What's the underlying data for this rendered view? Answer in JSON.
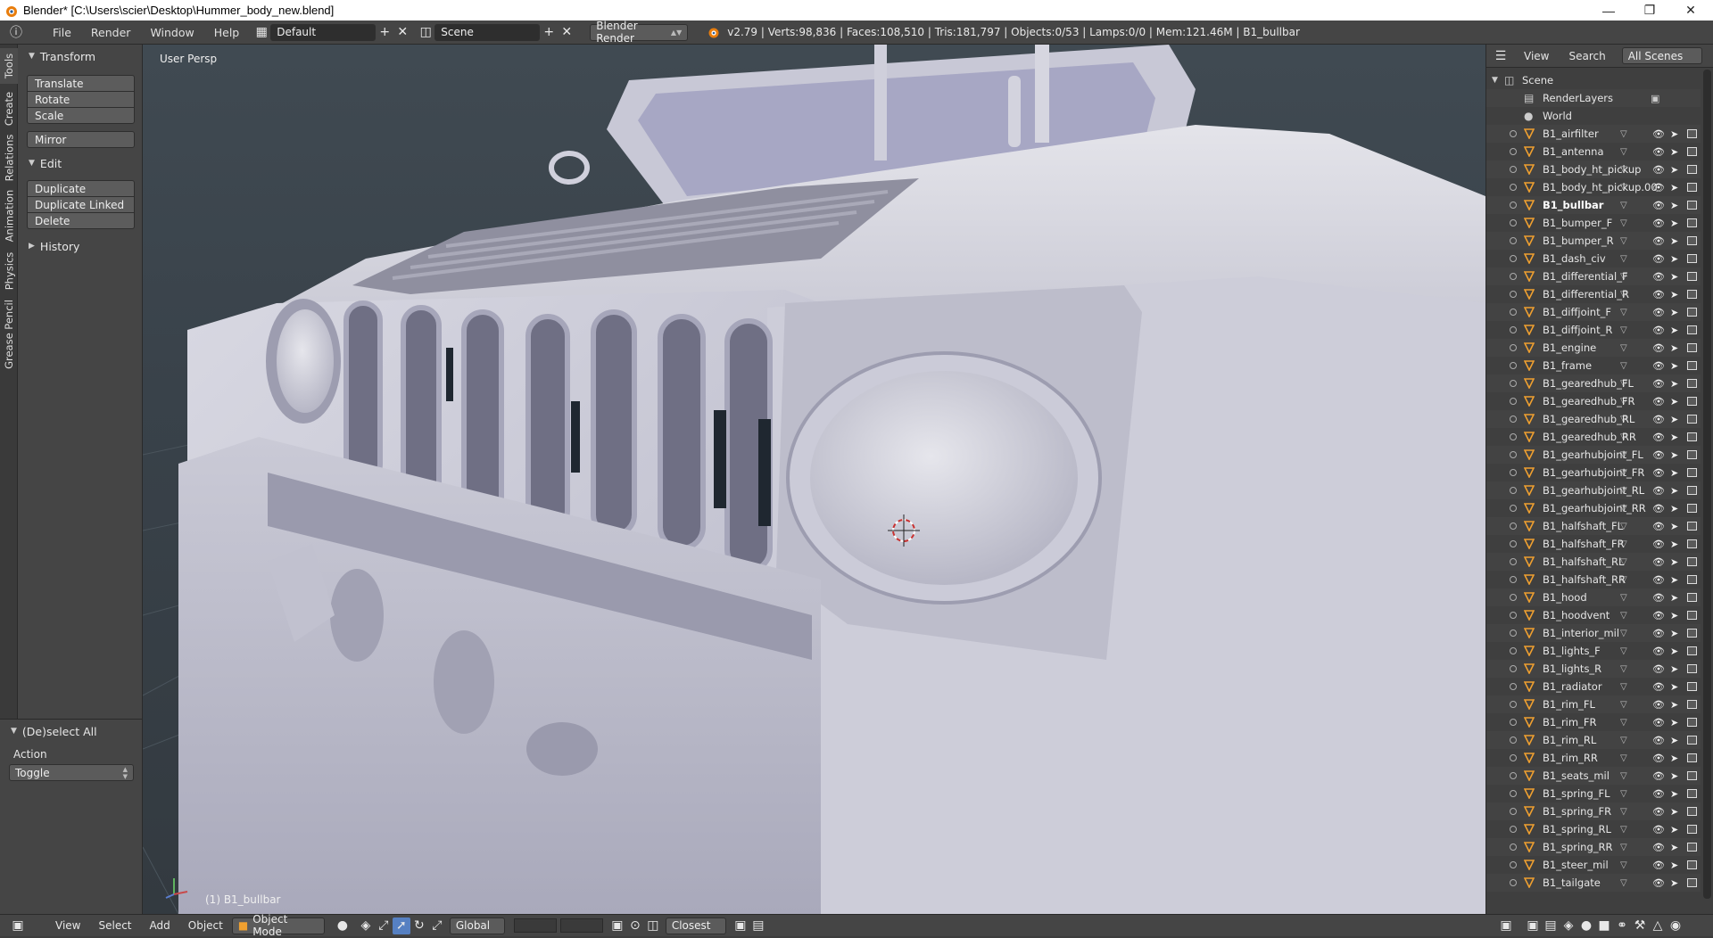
{
  "window": {
    "title": "Blender* [C:\\Users\\scier\\Desktop\\Hummer_body_new.blend]",
    "controls": [
      "minimize",
      "restore",
      "close"
    ]
  },
  "menubar": {
    "menus": [
      "File",
      "Render",
      "Window",
      "Help"
    ],
    "screen_layout": "Default",
    "scene": "Scene",
    "render_engine": "Blender Render",
    "stats": "v2.79 | Verts:98,836 | Faces:108,510 | Tris:181,797 | Objects:0/53 | Lamps:0/0 | Mem:121.46M | B1_bullbar"
  },
  "left_tabs": [
    "Tools",
    "Create",
    "Relations",
    "Animation",
    "Physics",
    "Grease Pencil"
  ],
  "toolshelf": {
    "transform": {
      "title": "Transform",
      "buttons": [
        "Translate",
        "Rotate",
        "Scale"
      ],
      "mirror": "Mirror"
    },
    "edit": {
      "title": "Edit",
      "buttons": [
        "Duplicate",
        "Duplicate Linked",
        "Delete"
      ]
    },
    "history": {
      "title": "History"
    }
  },
  "operator": {
    "title": "(De)select All",
    "action_label": "Action",
    "action_value": "Toggle"
  },
  "viewport": {
    "view_name": "User Persp",
    "active_object": "(1) B1_bullbar",
    "colors": {
      "background": "#3a434b",
      "model": "#c9c9d6",
      "cursor": "#c83232"
    }
  },
  "outliner": {
    "header": {
      "view": "View",
      "search": "Search",
      "display_mode": "All Scenes"
    },
    "scene_root": "Scene",
    "render_layers": "RenderLayers",
    "world": "World",
    "selected": "B1_bullbar",
    "objects": [
      "B1_airfilter",
      "B1_antenna",
      "B1_body_ht_pickup",
      "B1_body_ht_pickup.00",
      "B1_bullbar",
      "B1_bumper_F",
      "B1_bumper_R",
      "B1_dash_civ",
      "B1_differential_F",
      "B1_differential_R",
      "B1_diffjoint_F",
      "B1_diffjoint_R",
      "B1_engine",
      "B1_frame",
      "B1_gearedhub_FL",
      "B1_gearedhub_FR",
      "B1_gearedhub_RL",
      "B1_gearedhub_RR",
      "B1_gearhubjoint_FL",
      "B1_gearhubjoint_FR",
      "B1_gearhubjoint_RL",
      "B1_gearhubjoint_RR",
      "B1_halfshaft_FL",
      "B1_halfshaft_FR",
      "B1_halfshaft_RL",
      "B1_halfshaft_RR",
      "B1_hood",
      "B1_hoodvent",
      "B1_interior_mil",
      "B1_lights_F",
      "B1_lights_R",
      "B1_radiator",
      "B1_rim_FL",
      "B1_rim_FR",
      "B1_rim_RL",
      "B1_rim_RR",
      "B1_seats_mil",
      "B1_spring_FL",
      "B1_spring_FR",
      "B1_spring_RL",
      "B1_spring_RR",
      "B1_steer_mil",
      "B1_tailgate"
    ]
  },
  "statusbar": {
    "menus": [
      "View",
      "Select",
      "Add",
      "Object"
    ],
    "mode": "Object Mode",
    "orientation": "Global",
    "snap": "Closest"
  }
}
